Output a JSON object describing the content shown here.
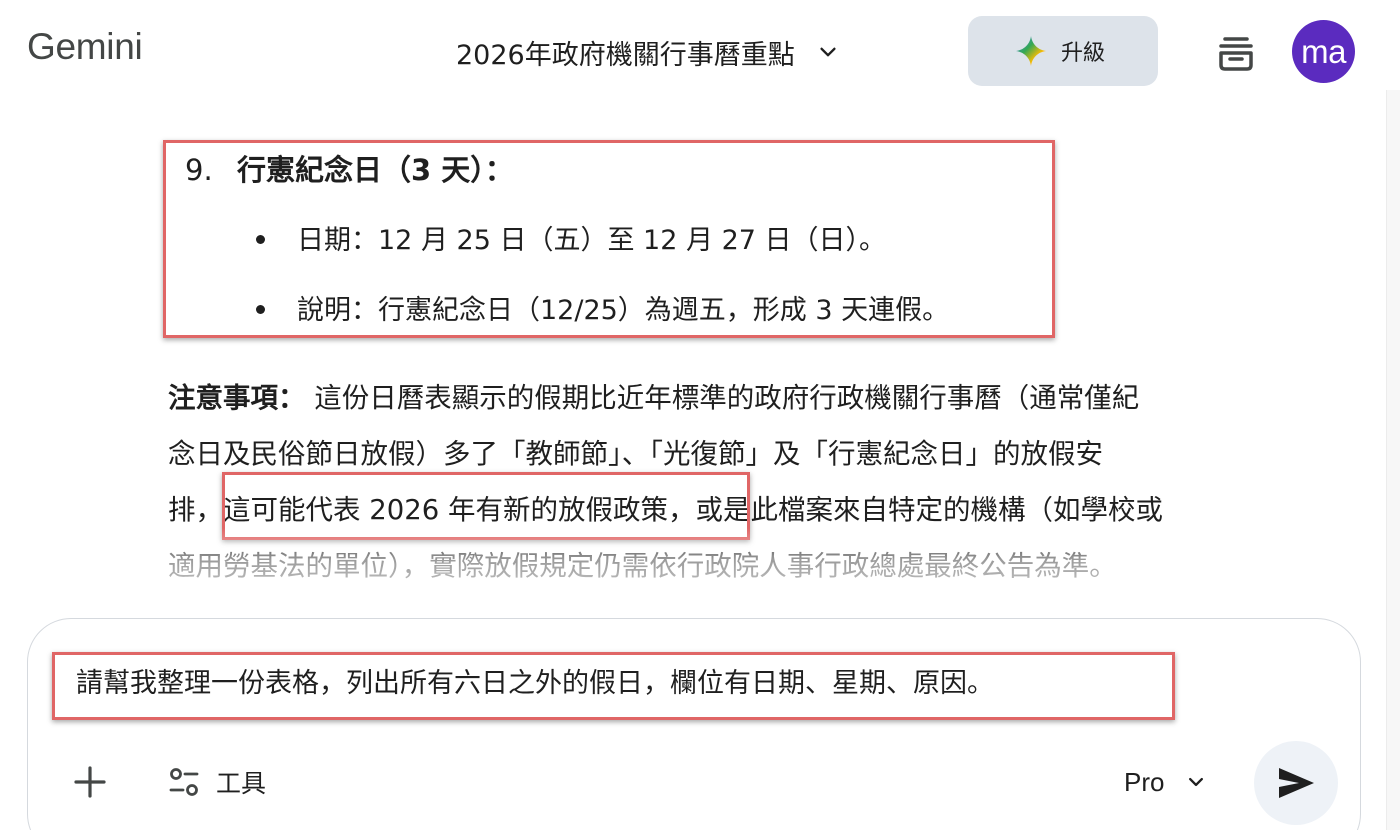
{
  "header": {
    "logo": "Gemini",
    "conversation_title": "2026年政府機關行事曆重點",
    "upgrade_label": "升級",
    "avatar_initials": "ma"
  },
  "response": {
    "item": {
      "number": "9.",
      "title": "行憲紀念日（3 天）：",
      "bullets": [
        "日期：12 月 25 日（五）至 12 月 27 日（日）。",
        "說明：行憲紀念日（12/25）為週五，形成 3 天連假。"
      ]
    },
    "note": {
      "label": "注意事項：",
      "lines": [
        " 這份日曆表顯示的假期比近年標準的政府行政機關行事曆（通常僅紀",
        "念日及民俗節日放假）多了「教師節」、「光復節」及「行憲紀念日」的放假安",
        "排，",
        "這可能代表 2026 年有新的放假政策",
        "，或是此檔案來自特定的機構（如學校或",
        "適用勞基法的單位），實際放假規定仍需依行政院人事行政總處最終公告為準。"
      ]
    }
  },
  "input": {
    "prompt_text": "請幫我整理一份表格，列出所有六日之外的假日，欄位有日期、星期、原因。",
    "tools_label": "工具",
    "model_label": "Pro"
  },
  "colors": {
    "highlight": "#e06666",
    "avatar_bg": "#5b2bbf",
    "upgrade_bg": "#dde3ea",
    "send_bg": "#eef2f7"
  },
  "icons": {
    "title_dropdown": "chevron-down-icon",
    "upgrade": "gemini-sparkle-icon",
    "chat_history": "chat-stack-icon",
    "add": "plus-icon",
    "tools": "tools-sliders-icon",
    "model_dropdown": "chevron-down-icon",
    "send": "send-arrow-icon"
  }
}
